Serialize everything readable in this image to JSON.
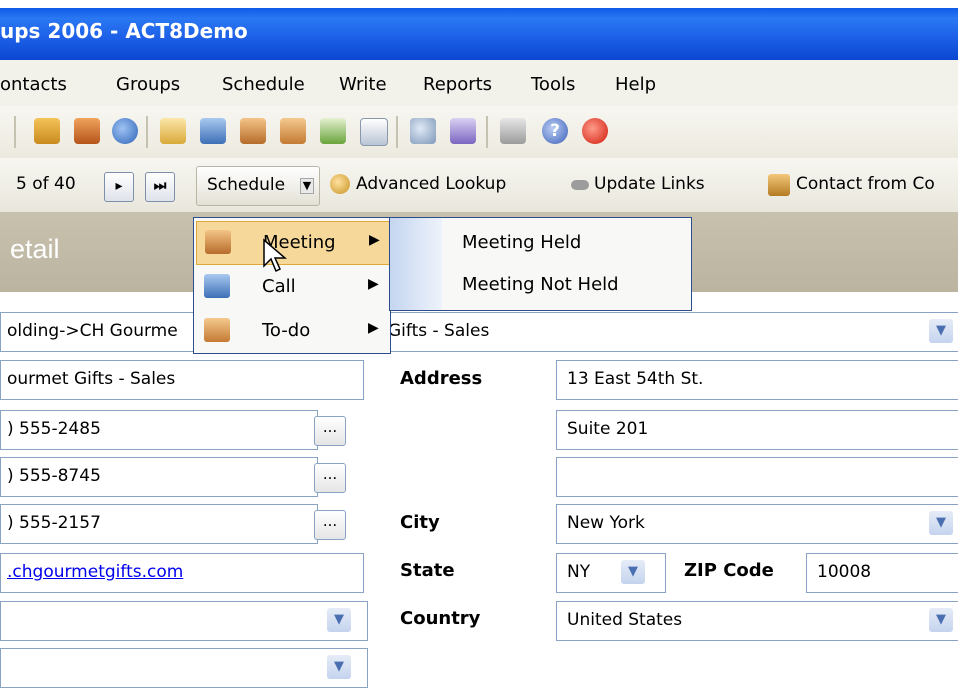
{
  "window": {
    "title": "ups 2006 - ACT8Demo"
  },
  "menubar": {
    "items": [
      "ontacts",
      "Groups",
      "Schedule",
      "Write",
      "Reports",
      "Tools",
      "Help"
    ]
  },
  "toolbar": {
    "icons": [
      "home-icon",
      "contacts-icon",
      "groups-icon",
      "schedule-icon",
      "call-icon",
      "meeting-icon",
      "todo-icon",
      "chart-icon",
      "note-icon",
      "lookup-icon",
      "tag-icon",
      "report-icon",
      "help-icon",
      "clock-icon"
    ]
  },
  "nav": {
    "record_position": "5 of 40",
    "schedule_label": "Schedule",
    "advanced_lookup": "Advanced Lookup",
    "update_links": "Update Links",
    "contact_from": "Contact from Co"
  },
  "detail": {
    "header": "etail"
  },
  "form": {
    "company_path": "olding->CH Gourme",
    "company_path_tail": "Gifts - Sales",
    "company_name": "ourmet Gifts - Sales",
    "phone1": ") 555-2485",
    "phone2": ") 555-8745",
    "phone3": ") 555-2157",
    "website": ".chgourmetgifts.com",
    "ellipsis": "...",
    "address_label": "Address",
    "address1": "13 East 54th St.",
    "address2": "Suite 201",
    "address3": "",
    "city_label": "City",
    "city": "New York",
    "state_label": "State",
    "state": "NY",
    "zip_label": "ZIP Code",
    "zip": "10008",
    "country_label": "Country",
    "country": "United States"
  },
  "context_menu": {
    "items": [
      {
        "label": "Meeting",
        "icon": "meeting-icon"
      },
      {
        "label": "Call",
        "icon": "phone-icon"
      },
      {
        "label": "To-do",
        "icon": "todo-icon"
      }
    ],
    "submenu": [
      "Meeting Held",
      "Meeting Not Held"
    ]
  },
  "colors": {
    "titlebar": "#1c5ee6",
    "detail_header": "#bfb9a5",
    "menu_highlight": "#f6d99a",
    "border": "#2c4e8c"
  }
}
